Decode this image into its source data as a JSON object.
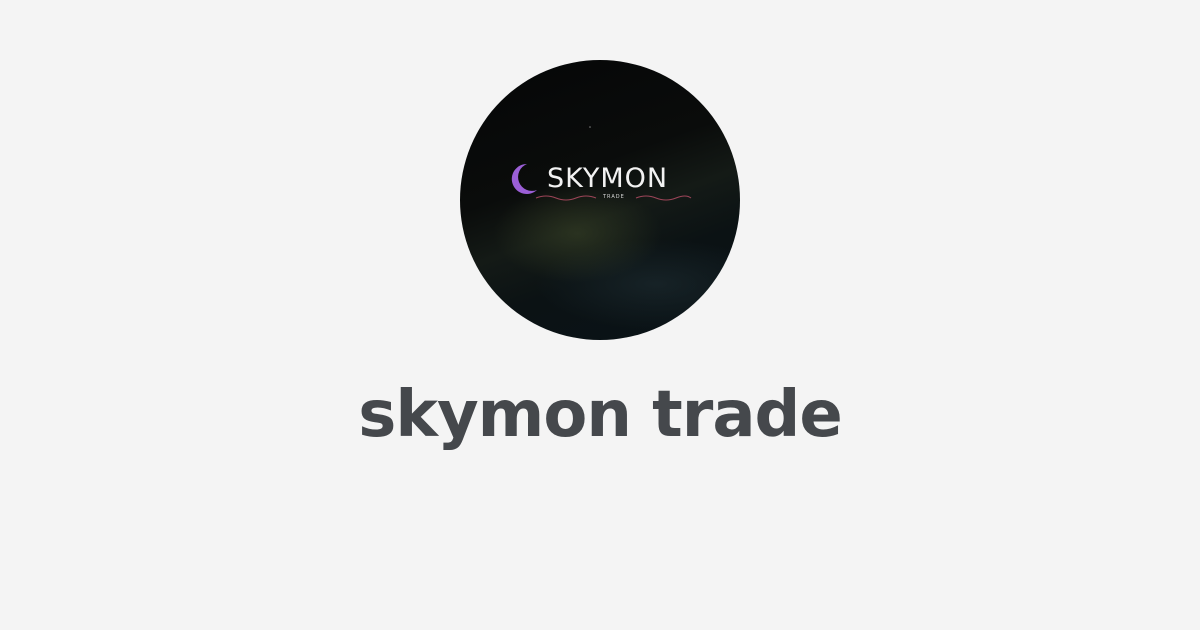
{
  "profile": {
    "name": "skymon trade",
    "avatar": {
      "icon": "skymon-trade-logo",
      "logo_text": "SKYMON",
      "logo_subtext": "TRADE"
    }
  },
  "colors": {
    "background": "#f4f4f4",
    "title": "#45484c",
    "crescent": "#9b5fd6",
    "wave_accent": "#c0506a"
  }
}
